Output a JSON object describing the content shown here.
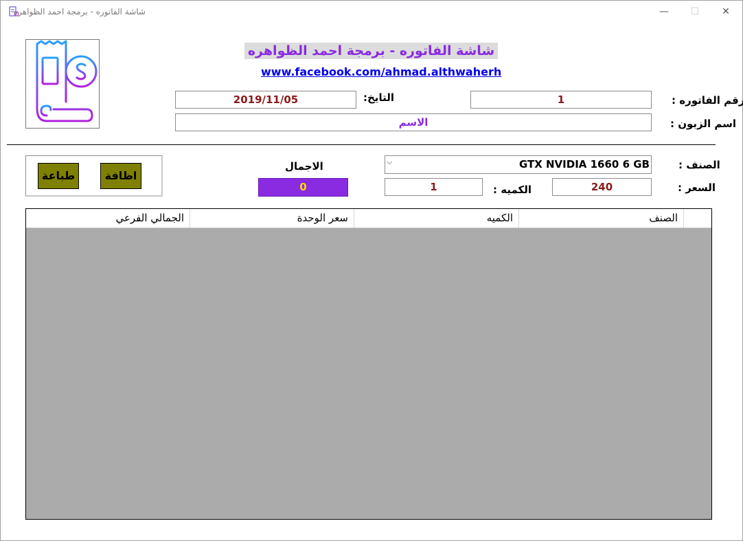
{
  "window": {
    "title": "شاشة الفاتوره - برمجة احمد الظواهره",
    "controls": {
      "minimize": "—",
      "maximize": "☐",
      "close": "✕"
    }
  },
  "header": {
    "title": "شاشة الفاتوره - برمجة احمد الظواهره",
    "link": "www.facebook.com/ahmad.althwaherh"
  },
  "invoice": {
    "number_label": "رقم الفاتوره :",
    "number_value": "1",
    "date_label": "التايخ:",
    "date_value": "2019/11/05",
    "customer_label": "اسم الزبون :",
    "customer_value": "الاسم"
  },
  "item": {
    "type_label": "الصنف :",
    "type_value": "GTX NVIDIA 1660 6 GB",
    "price_label": "السعر :",
    "price_value": "240",
    "qty_label": "الكميه :",
    "qty_value": "1",
    "total_label": "الاجمال",
    "total_value": "0"
  },
  "buttons": {
    "add": "اظافة",
    "print": "طباعة"
  },
  "grid": {
    "columns": [
      "الصنف",
      "الكميه",
      "سعر الوحدة",
      "الجمالي الفرعي"
    ],
    "rows": []
  },
  "colors": {
    "accent_purple": "#8a2be2",
    "button_olive": "#808000",
    "value_darkred": "#8b1a1a",
    "total_text": "#ffd700",
    "grid_bg": "#ababab"
  },
  "icons": {
    "app": "receipt-icon",
    "logo": "receipt-dollar-icon"
  }
}
